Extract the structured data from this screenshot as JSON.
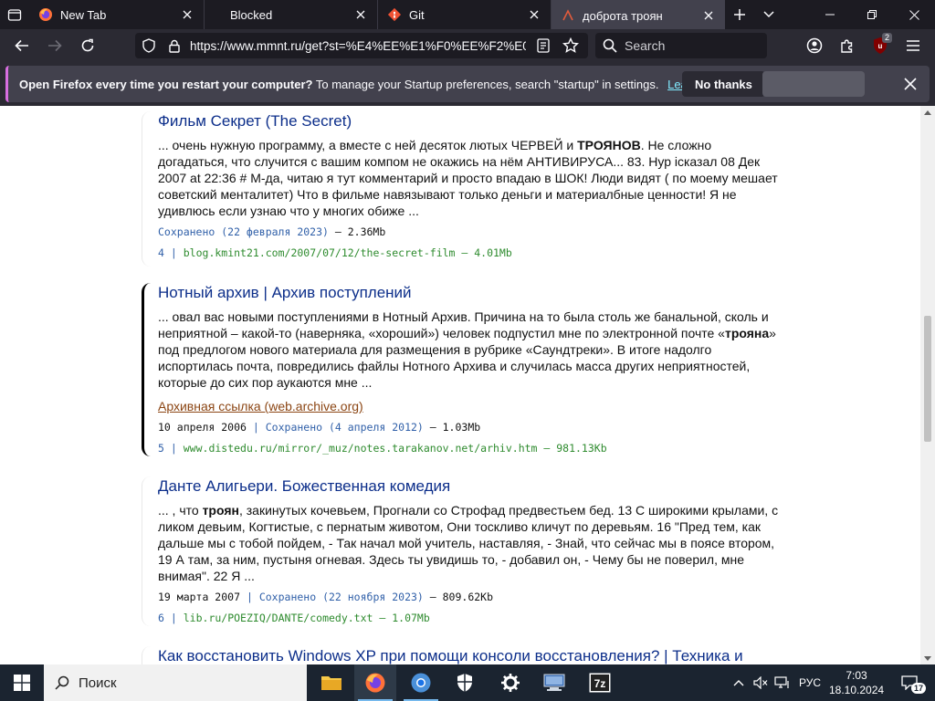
{
  "tabs": [
    {
      "label": "New Tab",
      "icon": "firefox-icon"
    },
    {
      "label": "Blocked",
      "icon": ""
    },
    {
      "label": "Git",
      "icon": "git-icon"
    },
    {
      "label": "доброта троян",
      "icon": "site-icon"
    }
  ],
  "navbar": {
    "url": "https://www.mmnt.ru/get?st=%E4%EE%E1%F0%EE%F2%E0+",
    "search_placeholder": "Search",
    "extension_badge": "2"
  },
  "notification": {
    "title": "Open Firefox every time you restart your computer?",
    "message": "To manage your Startup preferences, search \"startup\" in settings.",
    "learn_more": "Learn more",
    "no_thanks": "No thanks"
  },
  "results": [
    {
      "title": "Фильм Секрет (The Secret)",
      "snippet_pre": "... очень нужную программу, а вместе с ней десяток лютых ЧЕРВЕЙ и ",
      "snippet_bold": "ТРОЯНОВ",
      "snippet_post": ". Не сложно догадаться, что случится с вашим компом не окажись на нём АНТИВИРУСА... 83. Нур ісказал 08 Дек 2007 at 22:36 # М-да, читаю я тут комментарий и просто впадаю в ШОК! Люди видят ( по моему мешает советский менталитет) Что в фильме навязывают только деньги и материалбные ценности! Я не удивлюсь если узнаю что у многих обиже ...",
      "date": "",
      "saved": "Сохранено (22 февраля 2023)",
      "size": "– 2.36Mb",
      "num": "4",
      "src": "blog.kmint21.com/2007/07/12/the-secret-film – 4.01Mb"
    },
    {
      "title": "Нотный архив | Архив поступлений",
      "snippet_pre": "... овал вас новыми поступлениями в Нотный Архив. Причина на то была столь же банальной, сколь и неприятной – какой-то (наверняка, «хороший») человек подпустил мне по электронной почте «",
      "snippet_bold": "трояна",
      "snippet_post": "» под предлогом нового материала для размещения в рубрике «Саундтреки». В итоге надолго испортилась почта, повредились файлы Нотного Архива и случилась масса других неприятностей, которые до сих пор аукаются мне ...",
      "archive": "Архивная ссылка (web.archive.org)",
      "date": "10 апреля 2006",
      "saved": "Сохранено (4 апреля 2012)",
      "size": "– 1.03Mb",
      "num": "5",
      "src": "www.distedu.ru/mirror/_muz/notes.tarakanov.net/arhiv.htm – 981.13Kb"
    },
    {
      "title": "Данте Алигьери. Божественная комедия",
      "snippet_pre": "... , что ",
      "snippet_bold": "троян",
      "snippet_post": ", закинутых кочевьем, Прогнали со Строфад предвестьем бед. 13 С широкими крылами, с ликом девьим, Когтистые, с пернатым животом, Они тоскливо кличут по деревьям. 16 \"Пред тем, как дальше мы с тобой пойдем, - Так начал мой учитель, наставляя, - Знай, что сейчас мы в поясе втором, 19 А там, за ним, пустыня огневая. Здесь ты увидишь то, - добавил он, - Чему бы не поверил, мне внимая\". 22 Я ...",
      "date": "19 марта 2007",
      "saved": "Сохранено (22 ноября 2023)",
      "size": "– 809.62Kb",
      "num": "6",
      "src": "lib.ru/POEZIQ/DANTE/comedy.txt – 1.07Mb"
    },
    {
      "title": "Как восстановить Windows XP при помощи консоли восстановления? | Техника и"
    }
  ],
  "taskbar": {
    "search_label": "Поиск",
    "language": "РУС",
    "time": "7:03",
    "date": "18.10.2024",
    "notification_count": "17"
  }
}
